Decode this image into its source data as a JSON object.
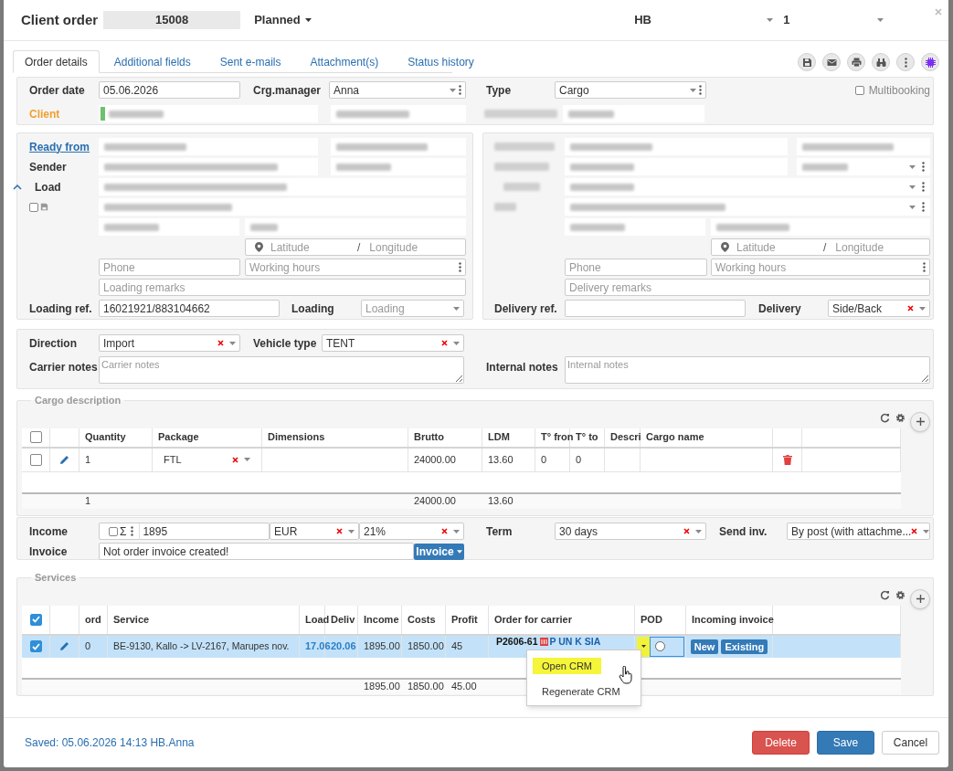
{
  "header": {
    "title": "Client order",
    "order_no": "15008",
    "status": "Planned",
    "company": "HB",
    "number": "1"
  },
  "tabs": [
    {
      "label": "Order details",
      "selected": true
    },
    {
      "label": "Additional fields",
      "selected": false
    },
    {
      "label": "Sent e-mails",
      "selected": false
    },
    {
      "label": "Attachment(s)",
      "selected": false
    },
    {
      "label": "Status history",
      "selected": false
    }
  ],
  "order": {
    "order_date_label": "Order date",
    "order_date": "05.06.2026",
    "manager_label": "Crg.manager",
    "manager": "Anna",
    "type_label": "Type",
    "type": "Cargo",
    "multibooking_label": "Multibooking",
    "multibooking": false,
    "client_label": "Client"
  },
  "loading": {
    "ready_label": "Ready from",
    "sender_label": "Sender",
    "load_label": "Load",
    "remember": false,
    "latitude_placeholder": "Latitude",
    "separator": "/",
    "longitude_placeholder": "Longitude",
    "phone_placeholder": "Phone",
    "hours_placeholder": "Working hours",
    "remarks_placeholder": "Loading remarks",
    "ref_label": "Loading ref.",
    "ref": "16021921/883104662",
    "type_label": "Loading",
    "type_placeholder": "Loading"
  },
  "delivery": {
    "latitude_placeholder": "Latitude",
    "separator": "/",
    "longitude_placeholder": "Longitude",
    "phone_placeholder": "Phone",
    "hours_placeholder": "Working hours",
    "remarks_placeholder": "Delivery remarks",
    "ref_label": "Delivery ref.",
    "type_label": "Delivery",
    "type": "Side/Back"
  },
  "transport": {
    "direction_label": "Direction",
    "direction": "Import",
    "vehicle_label": "Vehicle type",
    "vehicle": "TENT",
    "carrier_notes_label": "Carrier notes",
    "carrier_notes_placeholder": "Carrier notes",
    "internal_notes_label": "Internal notes",
    "internal_notes_placeholder": "Internal notes"
  },
  "cargo": {
    "title": "Cargo description",
    "header_checked": false,
    "columns": [
      "Quantity",
      "Package",
      "Dimensions",
      "Brutto",
      "LDM",
      "T° fron",
      "T° to",
      "Descri",
      "Cargo name"
    ],
    "rows": [
      {
        "checked": false,
        "quantity": "1",
        "package": "FTL",
        "brutto": "24000.00",
        "ldm": "13.60",
        "t_from": "0",
        "t_to": "0"
      }
    ],
    "totals": {
      "quantity": "1",
      "brutto": "24000.00",
      "ldm": "13.60"
    }
  },
  "finance": {
    "income_label": "Income",
    "income_checked": false,
    "sum_symbol": "Σ",
    "income": "1895",
    "currency": "EUR",
    "vat": "21%",
    "term_label": "Term",
    "term": "30 days",
    "send_label": "Send inv.",
    "send": "By post (with attachme...",
    "invoice_label": "Invoice",
    "invoice": "Not order invoice created!",
    "invoice_button": "Invoice"
  },
  "services": {
    "title": "Services",
    "header_checked": true,
    "columns": [
      "ord",
      "Service",
      "Load",
      "Deliv",
      "Income",
      "Costs",
      "Profit",
      "Order for carrier",
      "POD",
      "Incoming invoice"
    ],
    "rows": [
      {
        "checked": true,
        "selected": true,
        "ord": "0",
        "service": "BE-9130, Kallo -> LV-2167, Marupes nov.",
        "load": "17.06",
        "deliv": "20.06",
        "income": "1895.00",
        "costs": "1850.00",
        "profit": "45",
        "order": "P2606-61",
        "carrier": "P UN K SIA",
        "pod_checked": false,
        "new_button": "New",
        "existing_button": "Existing"
      }
    ],
    "totals": {
      "income": "1895.00",
      "costs": "1850.00",
      "profit": "45.00"
    }
  },
  "context_menu": {
    "items": [
      {
        "label": "Open CRM",
        "selected": true
      },
      {
        "label": "Regenerate CRM",
        "selected": false
      }
    ]
  },
  "footer": {
    "saved": "Saved: 05.06.2026 14:13 HB.Anna",
    "buttons": [
      {
        "label": "Delete",
        "kind": "danger"
      },
      {
        "label": "Save",
        "kind": "primary"
      },
      {
        "label": "Cancel",
        "kind": "default"
      }
    ]
  }
}
